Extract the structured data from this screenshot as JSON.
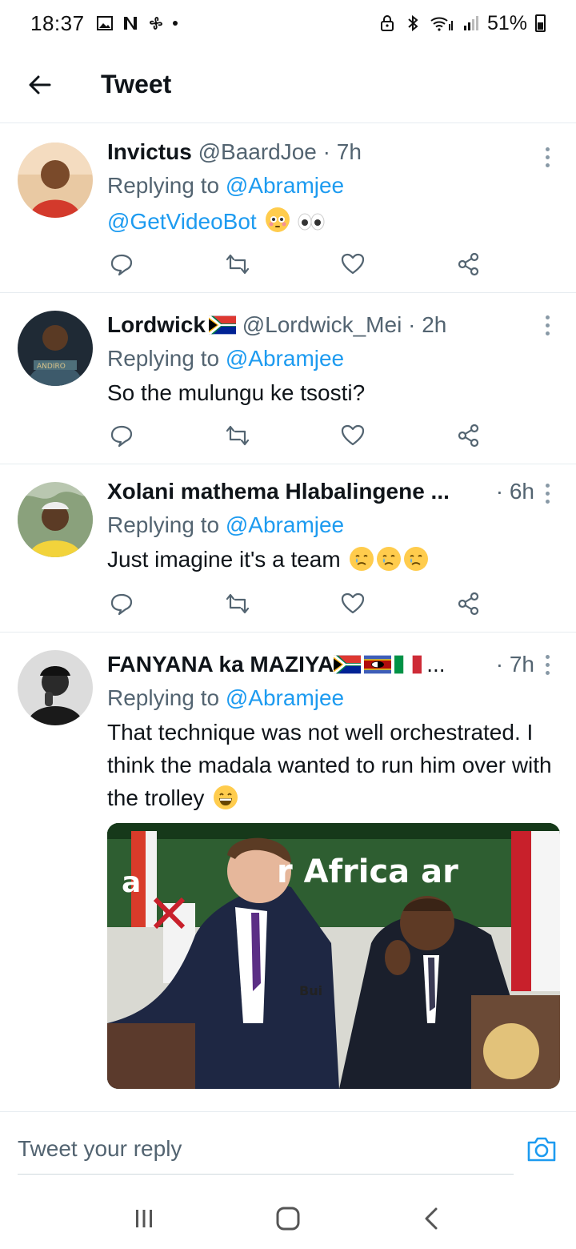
{
  "status_bar": {
    "time": "18:37",
    "battery": "51%"
  },
  "header": {
    "title": "Tweet",
    "back_icon": "arrow-left-icon"
  },
  "tweets": [
    {
      "name": "Invictus",
      "handle": "@BaardJoe",
      "time": "· 7h",
      "replying_prefix": "Replying to ",
      "replying_to": "@Abramjee",
      "text_mention": "@GetVideoBot",
      "emojis": [
        "flushed-face",
        "eyes"
      ]
    },
    {
      "name": "Lordwick",
      "name_flags": [
        "south-africa-flag"
      ],
      "handle": "@Lordwick_Mei",
      "time": "· 2h",
      "replying_prefix": "Replying to ",
      "replying_to": "@Abramjee",
      "text": "So the mulungu ke tsosti?"
    },
    {
      "name": "Xolani mathema Hlabalingene ...",
      "time": "· 6h",
      "replying_prefix": "Replying to ",
      "replying_to": "@Abramjee",
      "text": "Just imagine it's a team",
      "emojis": [
        "crying-face",
        "crying-face",
        "crying-face"
      ]
    },
    {
      "name": "FANYANA ka MAZIYA",
      "name_suffix": "...",
      "name_flags": [
        "south-africa-flag",
        "eswatini-flag",
        "italy-flag"
      ],
      "time": "· 7h",
      "replying_prefix": "Replying to ",
      "replying_to": "@Abramjee",
      "text": "That technique was not well orchestrated. I think the madala wanted to run him over with the trolley",
      "emojis": [
        "grinning-face"
      ],
      "media": {
        "banner_text_1": "a",
        "banner_text_2": "r Africa ar",
        "banner_text_3": "Bui"
      }
    }
  ],
  "reply_bar": {
    "placeholder": "Tweet your reply",
    "camera_icon": "camera-icon"
  },
  "colors": {
    "accent": "#1d9bf0",
    "secondary_text": "#536471",
    "primary_text": "#0f1419"
  }
}
